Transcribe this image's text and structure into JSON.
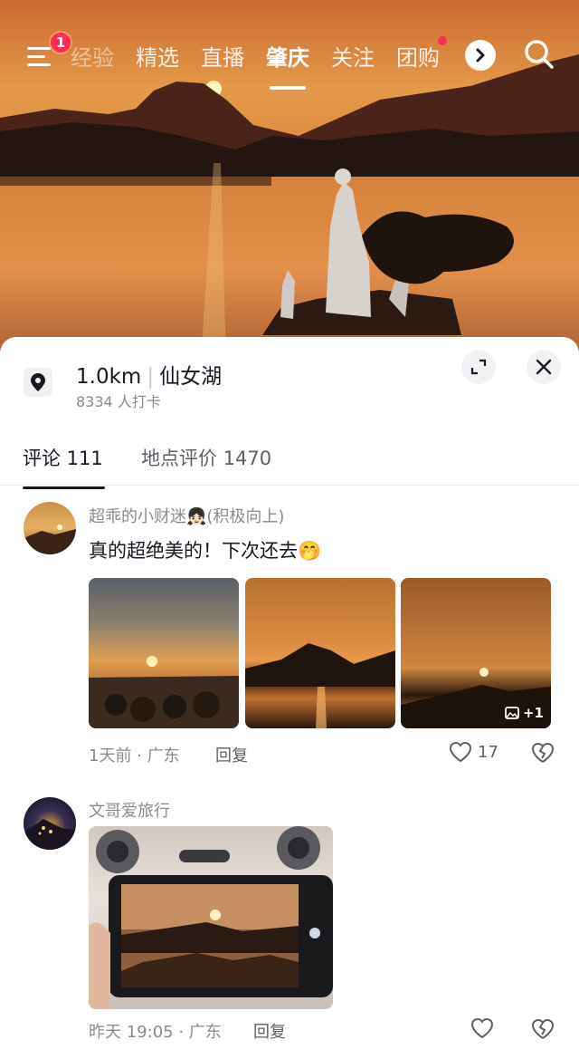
{
  "topnav": {
    "menu_badge": "1",
    "tabs": [
      "经验",
      "精选",
      "直播",
      "肇庆",
      "关注",
      "团购"
    ],
    "active_tab": "肇庆"
  },
  "icons": {
    "menu": "menu-icon",
    "more": "chevron-right-icon",
    "search": "search-icon",
    "location": "location-pin-icon",
    "expand": "expand-icon",
    "close": "close-icon",
    "like": "heart-icon",
    "dislike": "broken-heart-icon",
    "gallery": "image-icon"
  },
  "location": {
    "distance": "1.0km",
    "name": "仙女湖",
    "checkins": "8334 人打卡"
  },
  "content_tabs": {
    "comments": "评论 111",
    "place_reviews": "地点评价 1470"
  },
  "comments": [
    {
      "username": "超乖的小财迷👧🏻(积极向上)",
      "text": "真的超绝美的！下次还去🤭",
      "photo_count_badge": "+1",
      "time_location": "1天前 · 广东",
      "reply_label": "回复",
      "likes": "17"
    },
    {
      "username": "文哥爱旅行",
      "time_location": "昨天 19:05 · 广东",
      "reply_label": "回复"
    }
  ],
  "colors": {
    "accent_red": "#fe2c55",
    "text_primary": "#161823",
    "text_secondary": "#8a8b91"
  }
}
